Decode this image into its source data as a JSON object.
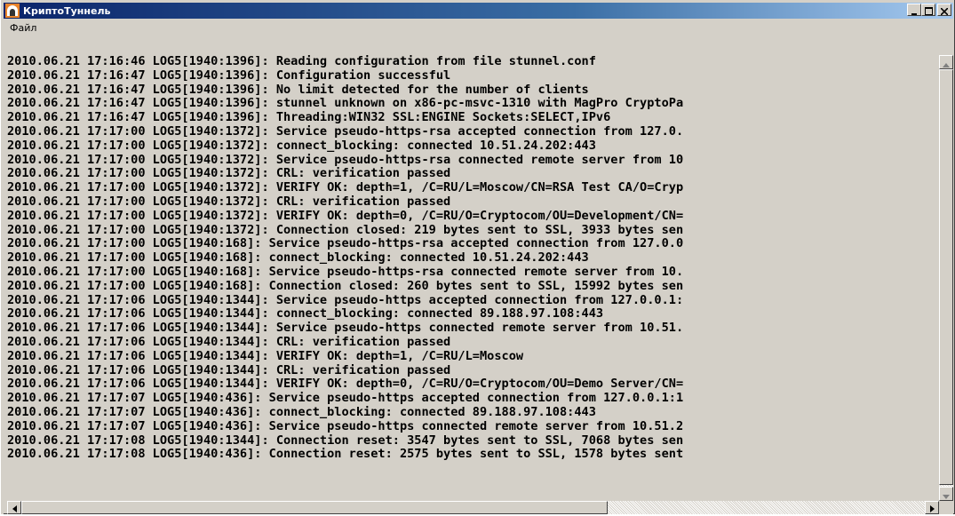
{
  "window": {
    "title": "КриптоТуннель",
    "icon": "tunnel-app-icon",
    "buttons": [
      "minimize-icon",
      "maximize-icon",
      "close-icon"
    ]
  },
  "menu": {
    "items": [
      {
        "label": "Файл"
      }
    ]
  },
  "log": {
    "lines": [
      "2010.06.21 17:16:46 LOG5[1940:1396]: Reading configuration from file stunnel.conf",
      "2010.06.21 17:16:47 LOG5[1940:1396]: Configuration successful",
      "2010.06.21 17:16:47 LOG5[1940:1396]: No limit detected for the number of clients",
      "2010.06.21 17:16:47 LOG5[1940:1396]: stunnel unknown on x86-pc-msvc-1310 with MagPro CryptoPa",
      "2010.06.21 17:16:47 LOG5[1940:1396]: Threading:WIN32 SSL:ENGINE Sockets:SELECT,IPv6",
      "2010.06.21 17:17:00 LOG5[1940:1372]: Service pseudo-https-rsa accepted connection from 127.0.",
      "2010.06.21 17:17:00 LOG5[1940:1372]: connect_blocking: connected 10.51.24.202:443",
      "2010.06.21 17:17:00 LOG5[1940:1372]: Service pseudo-https-rsa connected remote server from 10",
      "2010.06.21 17:17:00 LOG5[1940:1372]: CRL: verification passed",
      "2010.06.21 17:17:00 LOG5[1940:1372]: VERIFY OK: depth=1, /C=RU/L=Moscow/CN=RSA Test CA/O=Cryp",
      "2010.06.21 17:17:00 LOG5[1940:1372]: CRL: verification passed",
      "2010.06.21 17:17:00 LOG5[1940:1372]: VERIFY OK: depth=0, /C=RU/O=Cryptocom/OU=Development/CN=",
      "2010.06.21 17:17:00 LOG5[1940:1372]: Connection closed: 219 bytes sent to SSL, 3933 bytes sen",
      "2010.06.21 17:17:00 LOG5[1940:168]: Service pseudo-https-rsa accepted connection from 127.0.0",
      "2010.06.21 17:17:00 LOG5[1940:168]: connect_blocking: connected 10.51.24.202:443",
      "2010.06.21 17:17:00 LOG5[1940:168]: Service pseudo-https-rsa connected remote server from 10.",
      "2010.06.21 17:17:00 LOG5[1940:168]: Connection closed: 260 bytes sent to SSL, 15992 bytes sen",
      "2010.06.21 17:17:06 LOG5[1940:1344]: Service pseudo-https accepted connection from 127.0.0.1:",
      "2010.06.21 17:17:06 LOG5[1940:1344]: connect_blocking: connected 89.188.97.108:443",
      "2010.06.21 17:17:06 LOG5[1940:1344]: Service pseudo-https connected remote server from 10.51.",
      "2010.06.21 17:17:06 LOG5[1940:1344]: CRL: verification passed",
      "2010.06.21 17:17:06 LOG5[1940:1344]: VERIFY OK: depth=1, /C=RU/L=Moscow",
      "2010.06.21 17:17:06 LOG5[1940:1344]: CRL: verification passed",
      "2010.06.21 17:17:06 LOG5[1940:1344]: VERIFY OK: depth=0, /C=RU/O=Cryptocom/OU=Demo Server/CN=",
      "2010.06.21 17:17:07 LOG5[1940:436]: Service pseudo-https accepted connection from 127.0.0.1:1",
      "2010.06.21 17:17:07 LOG5[1940:436]: connect_blocking: connected 89.188.97.108:443",
      "2010.06.21 17:17:07 LOG5[1940:436]: Service pseudo-https connected remote server from 10.51.2",
      "2010.06.21 17:17:08 LOG5[1940:1344]: Connection reset: 3547 bytes sent to SSL, 7068 bytes sen",
      "2010.06.21 17:17:08 LOG5[1940:436]: Connection reset: 2575 bytes sent to SSL, 1578 bytes sent"
    ]
  },
  "colors": {
    "titlebar_start": "#0a246a",
    "titlebar_end": "#a6caf0",
    "window_face": "#d4d0c8",
    "text": "#000000"
  }
}
